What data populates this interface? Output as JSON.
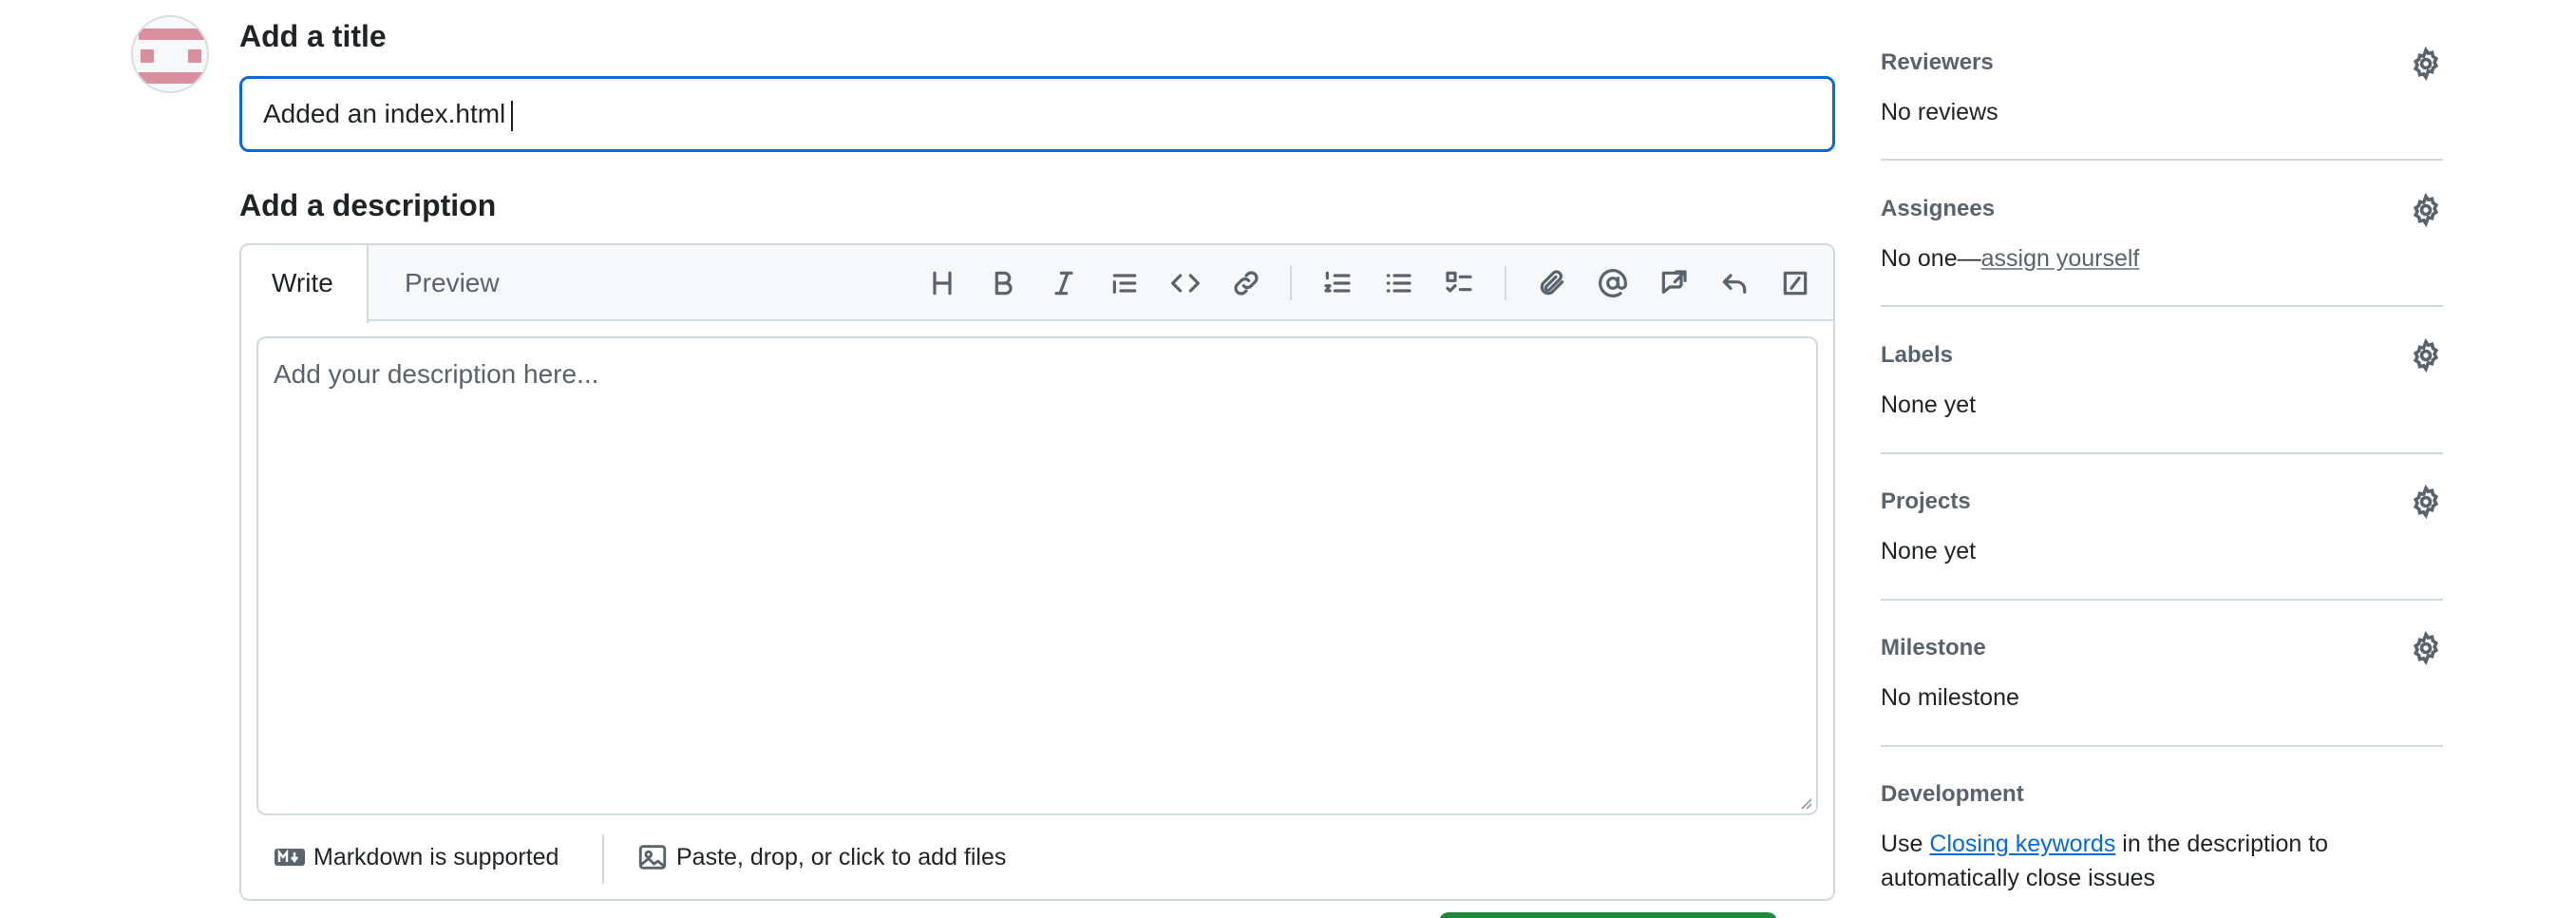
{
  "form": {
    "title_heading": "Add a title",
    "title_value": "Added an index.html",
    "description_heading": "Add a description",
    "description_placeholder": "Add your description here...",
    "tabs": [
      {
        "label": "Write",
        "active": true
      },
      {
        "label": "Preview",
        "active": false
      }
    ],
    "toolbar_icons": [
      "heading-icon",
      "bold-icon",
      "italic-icon",
      "quote-icon",
      "code-icon",
      "link-icon",
      "ordered-list-icon",
      "unordered-list-icon",
      "task-list-icon",
      "attach-icon",
      "mention-icon",
      "reference-icon",
      "reply-icon",
      "slash-command-icon"
    ],
    "markdown_note": "Markdown is supported",
    "files_note": "Paste, drop, or click to add files"
  },
  "sidebar": {
    "reviewers": {
      "title": "Reviewers",
      "value": "No reviews"
    },
    "assignees": {
      "title": "Assignees",
      "value_prefix": "No one—",
      "value_link": "assign yourself"
    },
    "labels": {
      "title": "Labels",
      "value": "None yet"
    },
    "projects": {
      "title": "Projects",
      "value": "None yet"
    },
    "milestone": {
      "title": "Milestone",
      "value": "No milestone"
    },
    "development": {
      "title": "Development",
      "text_prefix": "Use ",
      "text_link": "Closing keywords",
      "text_suffix": " in the description to",
      "text_line2": "automatically close issues"
    }
  },
  "colors": {
    "accent": "#0969da",
    "success": "#1f883d",
    "muted": "#59636e",
    "border": "#d1d9e0"
  }
}
